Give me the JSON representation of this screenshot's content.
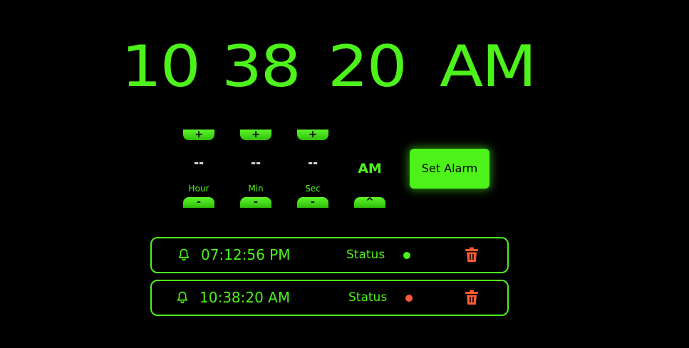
{
  "clock": {
    "hours": "10",
    "minutes": "38",
    "seconds": "20",
    "period": "AM"
  },
  "controls": {
    "increment_label": "+",
    "decrement_label": "-",
    "hour": {
      "value": "--",
      "label": "Hour"
    },
    "minute": {
      "value": "--",
      "label": "Min"
    },
    "second": {
      "value": "--",
      "label": "Sec"
    },
    "period": {
      "value": "AM",
      "toggle_label": "^"
    },
    "set_alarm_label": "Set Alarm"
  },
  "alarms": [
    {
      "time": "07:12:56 PM",
      "status_label": "Status",
      "status_color": "#4df21b"
    },
    {
      "time": "10:38:20 AM",
      "status_label": "Status",
      "status_color": "#ff5a36"
    }
  ],
  "colors": {
    "accent": "#4df21b",
    "background": "#000000",
    "delete": "#ff5a36",
    "placeholder_value": "#f2f2f2"
  },
  "icons": {
    "alarm_bell": "bell-icon",
    "delete": "trash-icon"
  }
}
